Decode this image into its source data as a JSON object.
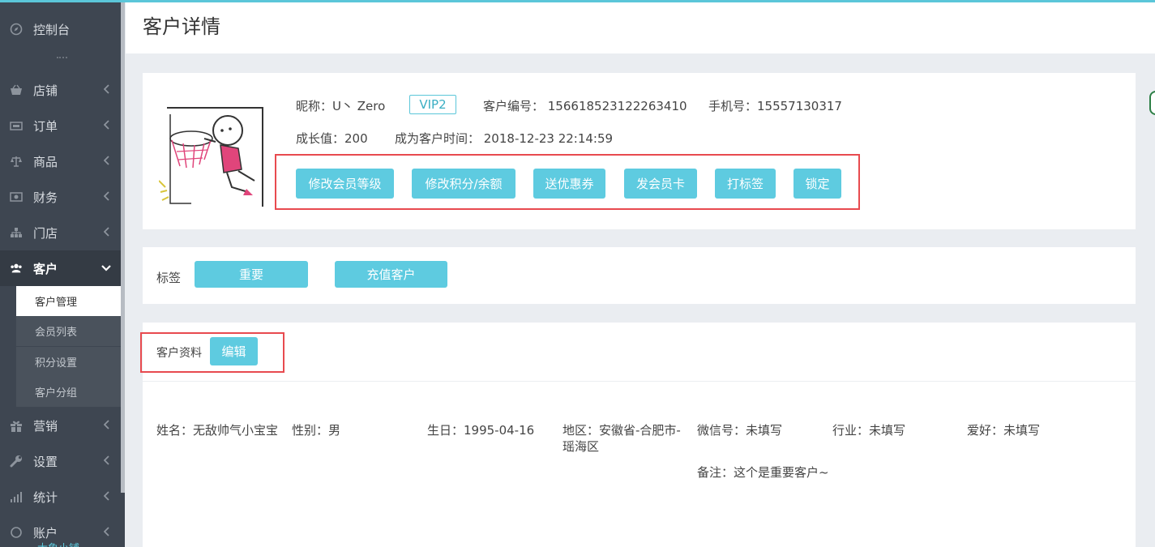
{
  "sidebar": {
    "dashboard": "控制台",
    "items": [
      {
        "label": "店铺",
        "icon": "basket-icon"
      },
      {
        "label": "订单",
        "icon": "ticket-icon"
      },
      {
        "label": "商品",
        "icon": "scale-icon"
      },
      {
        "label": "财务",
        "icon": "money-icon"
      },
      {
        "label": "门店",
        "icon": "sitemap-icon"
      },
      {
        "label": "客户",
        "icon": "users-icon"
      },
      {
        "label": "营销",
        "icon": "gift-icon"
      },
      {
        "label": "设置",
        "icon": "wrench-icon"
      },
      {
        "label": "统计",
        "icon": "signal-icon"
      },
      {
        "label": "账户",
        "icon": "account-icon"
      }
    ],
    "sub_items": [
      "客户管理",
      "会员列表",
      "积分设置",
      "客户分组"
    ],
    "bottom_text": "大象小铺"
  },
  "header": {
    "title": "客户详情"
  },
  "profile": {
    "nickname_label": "昵称：U丶 Zero",
    "vip": "VIP2",
    "customer_no": "客户编号： 156618523122263410",
    "phone": "手机号：15557130317",
    "growth": "成长值：200",
    "since": "成为客户时间： 2018-12-23 22:14:59",
    "actions": [
      "修改会员等级",
      "修改积分/余额",
      "送优惠券",
      "发会员卡",
      "打标签",
      "锁定"
    ]
  },
  "tags": {
    "label": "标签",
    "items": [
      "重要",
      "充值客户"
    ]
  },
  "customer_data": {
    "label": "客户资料",
    "edit": "编辑",
    "name": "姓名：无敌帅气小宝宝",
    "gender": "性别：男",
    "birthday": "生日：1995-04-16",
    "region_line1": "地区：安徽省-合肥市-",
    "region_line2": "瑶海区",
    "wechat": "微信号：未填写",
    "industry": "行业：未填写",
    "hobby": "爱好：未填写",
    "note": "备注：这个是重要客户~"
  },
  "colors": {
    "accent": "#5ecbe0",
    "sidebar": "#3e4651",
    "highlight_box": "#e84a4f"
  }
}
